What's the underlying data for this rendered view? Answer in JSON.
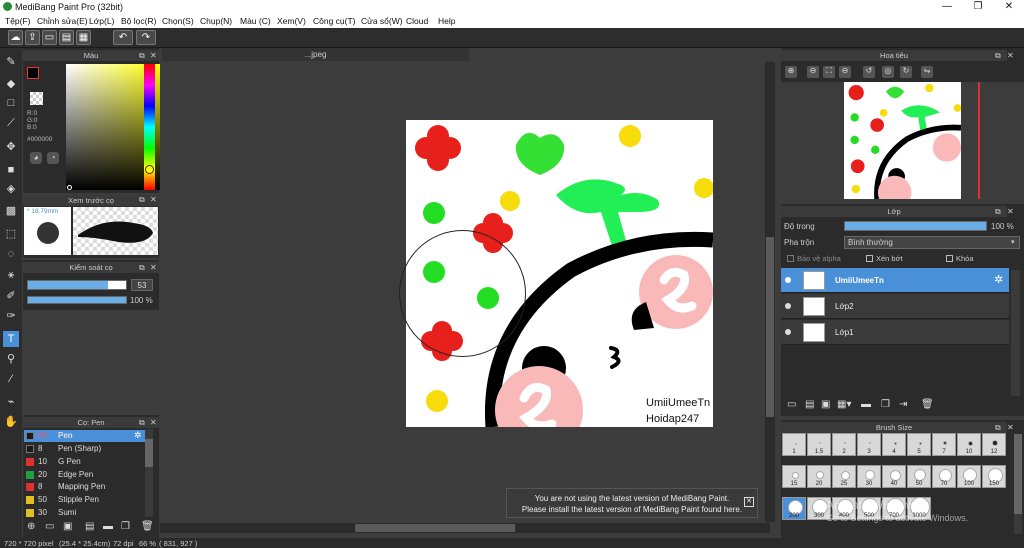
{
  "window": {
    "title": "MediBang Paint Pro (32bit)",
    "minimize": "—",
    "restore": "❐",
    "close": "✕"
  },
  "menu": [
    "Tệp(F)",
    "Chỉnh sửa(E)",
    "Lớp(L)",
    "Bộ lọc(R)",
    "Chọn(S)",
    "Chụp(N)",
    "Màu (C)",
    "Xem(V)",
    "Công cụ(T)",
    "Cửa sổ(W)",
    "Cloud",
    "Help"
  ],
  "document_tab": "...jpeg",
  "color_panel": {
    "title": "Màu",
    "r": "R:0",
    "g": "G:0",
    "b": "B:0",
    "hex": "#000000"
  },
  "brush_preview": {
    "title": "Xem trước cọ",
    "size": "* 18.79mm"
  },
  "brush_control": {
    "title": "Kiểm soát cọ",
    "size_value": "53",
    "opacity_value": "100 %",
    "size_fraction": 0.82,
    "opacity_fraction": 1.0
  },
  "brush_list": {
    "title": "Cọ: Pen",
    "items": [
      {
        "size": "53",
        "name": "Pen",
        "color": "#1a1a1a",
        "selected": true
      },
      {
        "size": "8",
        "name": "Pen (Sharp)",
        "color": "#1a1a1a"
      },
      {
        "size": "10",
        "name": "G Pen",
        "color": "#e03030"
      },
      {
        "size": "20",
        "name": "Edge Pen",
        "color": "#20a040"
      },
      {
        "size": "8",
        "name": "Mapping Pen",
        "color": "#e03030"
      },
      {
        "size": "50",
        "name": "Stipple Pen",
        "color": "#e0c020"
      },
      {
        "size": "30",
        "name": "Sumi",
        "color": "#e0c020"
      }
    ]
  },
  "canvas_art": {
    "text_line1": "UmiiUmeeTn",
    "text_line2": "Hoidap247"
  },
  "navigator": {
    "title": "Hoa tiêu"
  },
  "layers": {
    "title": "Lớp",
    "opacity_label": "Độ trong",
    "opacity_value": "100 %",
    "opacity_fraction": 1.0,
    "blend_label": "Pha trộn",
    "blend_value": "Bình thường",
    "protect_alpha": "Bảo vệ alpha",
    "clipping": "Xén bớt",
    "lock": "Khóa",
    "items": [
      {
        "name": "UmiiUmeeTn",
        "selected": true
      },
      {
        "name": "Lớp2"
      },
      {
        "name": "Lớp1"
      }
    ]
  },
  "brush_size": {
    "title": "Brush Size",
    "row1": [
      "1",
      "1.5",
      "2",
      "3",
      "4",
      "5",
      "7",
      "10",
      "12"
    ],
    "row2": [
      "15",
      "20",
      "25",
      "30",
      "40",
      "50",
      "70",
      "100",
      "150"
    ],
    "row3": [
      "200",
      "300",
      "400",
      "500",
      "700",
      "1000"
    ]
  },
  "notification": {
    "line1": "You are not using the latest version of MediBang Paint.",
    "line2": "Please install the latest version of MediBang Paint found here.",
    "close": "✕"
  },
  "watermark": {
    "line1": "Activate Windows",
    "line2": "Go to Settings to activate Windows."
  },
  "status": {
    "dimensions": "720 * 720 pixel",
    "physical": "(25.4 * 25.4cm)",
    "dpi": "72 dpi",
    "zoom": "66 %",
    "coords": "( 831, 927 )"
  },
  "colors": {
    "accent": "#4a90d9",
    "panel": "#2b2b2b",
    "canvas_bg": "#3c3c3c"
  }
}
